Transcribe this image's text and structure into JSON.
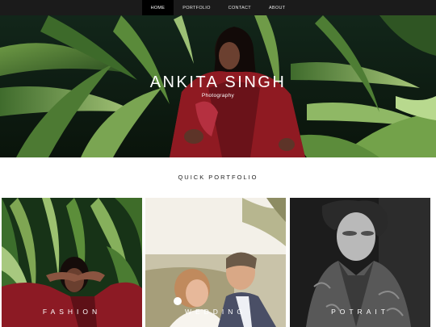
{
  "nav": {
    "items": [
      {
        "label": "HOME"
      },
      {
        "label": "PORTFOLIO"
      },
      {
        "label": "CONTACT"
      },
      {
        "label": "ABOUT"
      }
    ],
    "active_index": 0
  },
  "hero": {
    "title": "ANKITA SINGH",
    "subtitle": "Photography"
  },
  "portfolio": {
    "heading": "QUICK PORTFOLIO",
    "cards": [
      {
        "label": "FASHION"
      },
      {
        "label": "WEDDING"
      },
      {
        "label": "POTRAIT"
      }
    ]
  },
  "colors": {
    "nav_bg": "#1b1b1b",
    "nav_active_bg": "#000000",
    "foliage_dark": "#0f2412",
    "foliage_light": "#5f8f3a",
    "garment_red": "#8f1a22",
    "text_white": "#ffffff"
  }
}
